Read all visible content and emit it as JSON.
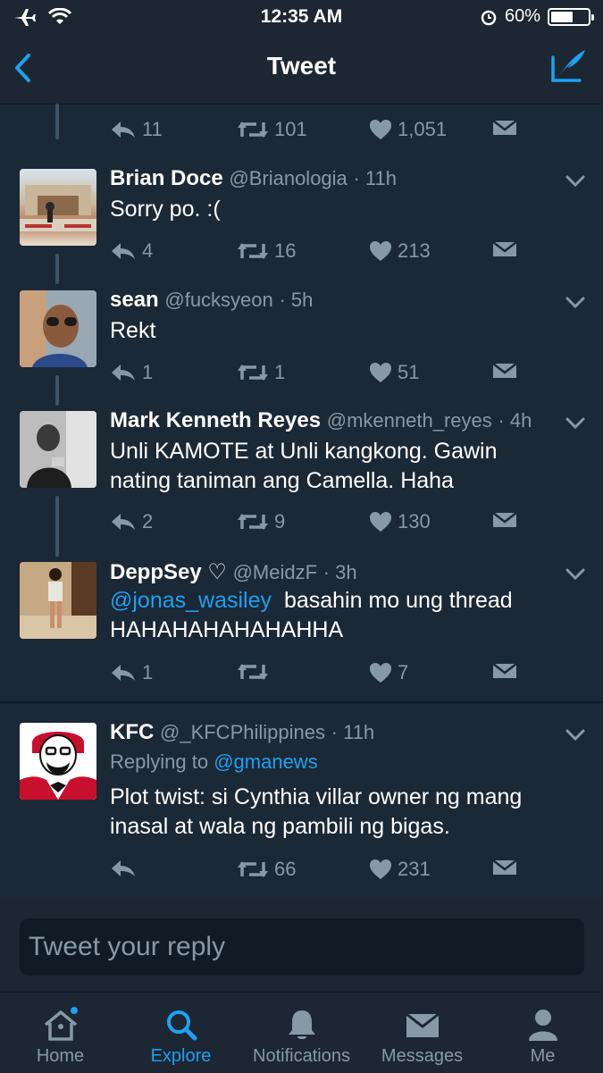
{
  "status_bar": {
    "time": "12:35 AM",
    "battery": "60%",
    "battery_level": 0.6
  },
  "nav": {
    "title": "Tweet"
  },
  "top_actions": {
    "replies": "11",
    "retweets": "101",
    "likes": "1,051"
  },
  "tweets": [
    {
      "name": "Brian Doce",
      "handle": "@Brianologia",
      "time": "· 11h",
      "lines": [
        "Sorry po. :("
      ],
      "replies": "4",
      "retweets": "16",
      "likes": "213"
    },
    {
      "name": "sean",
      "handle": "@fucksyeon",
      "time": "· 5h",
      "lines": [
        "Rekt"
      ],
      "replies": "1",
      "retweets": "1",
      "likes": "51"
    },
    {
      "name": "Mark Kenneth Reyes",
      "handle": "@mkenneth_reyes",
      "time": "· 4h",
      "lines": [
        "Unli KAMOTE at Unli kangkong. Gawin",
        "nating taniman ang Camella. Haha"
      ],
      "replies": "2",
      "retweets": "9",
      "likes": "130"
    },
    {
      "name": "DeppSey ♡",
      "handle": "@MeidzF",
      "time": "· 3h",
      "mention": "@jonas_wasiley",
      "lines": [
        "basahin mo ung thread",
        "HAHAHAHAHAHAHHA"
      ],
      "replies": "1",
      "retweets": "",
      "likes": "7"
    },
    {
      "name": "KFC",
      "handle": "@_KFCPhilippines",
      "time": "· 11h",
      "replying_prefix": "Replying to",
      "replying_to": "@gmanews",
      "lines": [
        "Plot twist: si Cynthia villar owner ng mang",
        "inasal at wala ng pambili ng bigas."
      ],
      "replies": "",
      "retweets": "66",
      "likes": "231"
    }
  ],
  "reply": {
    "placeholder": "Tweet your reply"
  },
  "tabs": [
    {
      "label": "Home",
      "icon": "home-icon"
    },
    {
      "label": "Explore",
      "icon": "search-icon"
    },
    {
      "label": "Notifications",
      "icon": "bell-icon"
    },
    {
      "label": "Messages",
      "icon": "envelope-icon"
    },
    {
      "label": "Me",
      "icon": "person-icon"
    }
  ],
  "colors": {
    "background": "#1b2836",
    "accent": "#1da1f2",
    "muted": "#8899a6"
  }
}
